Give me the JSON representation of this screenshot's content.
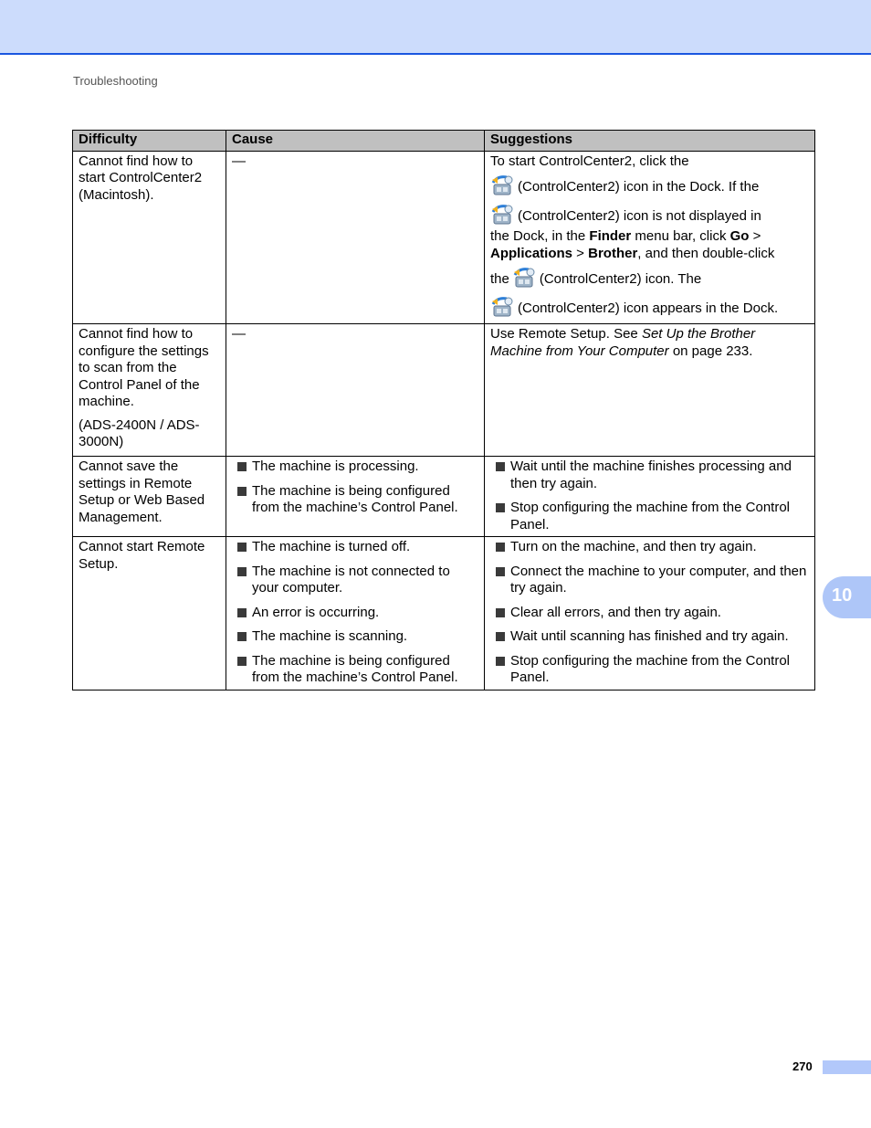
{
  "header": {
    "section_title": "Troubleshooting"
  },
  "table": {
    "columns": [
      "Difficulty",
      "Cause",
      "Suggestions"
    ],
    "rows": [
      {
        "difficulty": [
          "Cannot find how to start ControlCenter2 (Macintosh)."
        ],
        "cause_text": "—",
        "suggestion_parts": {
          "l1": "To start ControlCenter2, click the",
          "l2": "(ControlCenter2) icon in the Dock. If the",
          "l3": "(ControlCenter2) icon is not displayed in",
          "l4a": "the Dock, in the ",
          "l4b": "Finder",
          "l4c": " menu bar, click ",
          "l4d": "Go",
          "l4e": " >",
          "l5a": "Applications",
          "l5b": " > ",
          "l5c": "Brother",
          "l5d": ", and then double-click",
          "l6a": "the",
          "l6b": "(ControlCenter2) icon. The",
          "l7": "(ControlCenter2) icon appears in the Dock."
        }
      },
      {
        "difficulty": [
          "Cannot find how to configure the settings to scan from the Control Panel of the machine.",
          "(ADS-2400N / ADS-3000N)"
        ],
        "cause_text": "—",
        "suggestion_parts": {
          "a": "Use Remote Setup. See ",
          "b": "Set Up the Brother Machine from Your Computer",
          "c": " on page 233."
        }
      },
      {
        "difficulty": [
          "Cannot save the settings in Remote Setup or Web Based Management."
        ],
        "causes": [
          "The machine is processing.",
          "The machine is being configured from the machine’s Control Panel."
        ],
        "suggestions": [
          "Wait until the machine finishes processing and then try again.",
          "Stop configuring the machine from the Control Panel."
        ]
      },
      {
        "difficulty": [
          "Cannot start Remote Setup."
        ],
        "causes": [
          "The machine is turned off.",
          "The machine is not connected to your computer.",
          "An error is occurring.",
          "The machine is scanning.",
          "The machine is being configured from the machine’s Control Panel."
        ],
        "suggestions": [
          "Turn on the machine, and then try again.",
          "Connect the machine to your computer, and then try again.",
          "Clear all errors, and then try again.",
          "Wait until scanning has finished and try again.",
          "Stop configuring the machine from the Control Panel."
        ]
      }
    ]
  },
  "icons": {
    "controlcenter2": "controlcenter2-icon",
    "bullet": "square-bullet"
  },
  "chapter_tab": {
    "label": "10"
  },
  "footer": {
    "page_number": "270"
  },
  "colors": {
    "band": "#ccdcfc",
    "band_line": "#1a56e0",
    "tab": "#aec6f8",
    "header_row": "#c0c0c0"
  }
}
